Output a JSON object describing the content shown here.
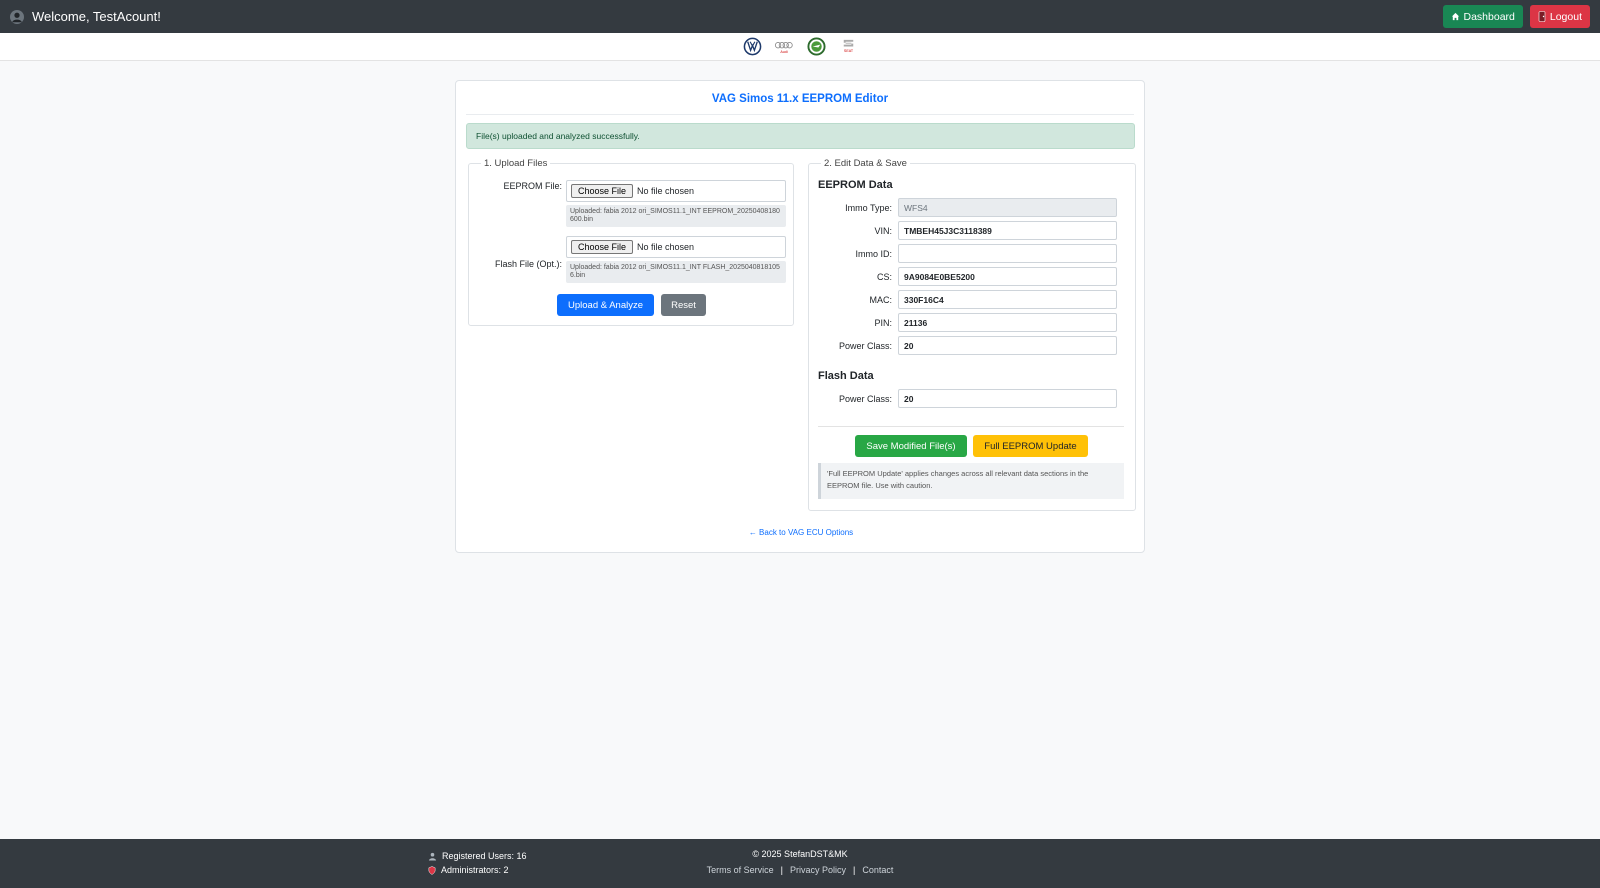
{
  "header": {
    "welcome": "Welcome, TestAcount!",
    "dashboard_label": "Dashboard",
    "logout_label": "Logout"
  },
  "brands": [
    "vw-logo",
    "audi-logo",
    "skoda-logo",
    "seat-logo"
  ],
  "brand_labels": {
    "audi": "Audi",
    "seat": "SEAT"
  },
  "card": {
    "title": "VAG Simos 11.x EEPROM Editor",
    "alert": "File(s) uploaded and analyzed successfully."
  },
  "upload": {
    "legend": "1. Upload Files",
    "eeprom_label": "EEPROM File:",
    "flash_label": "Flash File (Opt.):",
    "choose_label": "Choose File",
    "no_file": "No file chosen",
    "eeprom_uploaded": "Uploaded: fabia 2012 ori_SIMOS11.1_INT EEPROM_20250408180600.bin",
    "flash_uploaded": "Uploaded: fabia 2012 ori_SIMOS11.1_INT FLASH_20250408181056.bin",
    "upload_button": "Upload & Analyze",
    "reset_button": "Reset"
  },
  "edit": {
    "legend": "2. Edit Data & Save",
    "eeprom_heading": "EEPROM Data",
    "fields": [
      {
        "label": "Immo Type:",
        "value": "WFS4"
      },
      {
        "label": "VIN:",
        "value": "TMBEH45J3C3118389"
      },
      {
        "label": "Immo ID:",
        "value": ""
      },
      {
        "label": "CS:",
        "value": "9A9084E0BE5200"
      },
      {
        "label": "MAC:",
        "value": "330F16C4"
      },
      {
        "label": "PIN:",
        "value": "21136"
      },
      {
        "label": "Power Class:",
        "value": "20"
      }
    ],
    "flash_heading": "Flash Data",
    "flash_fields": [
      {
        "label": "Power Class:",
        "value": "20"
      }
    ],
    "save_button": "Save Modified File(s)",
    "full_update_button": "Full EEPROM Update",
    "hint": "'Full EEPROM Update' applies changes across all relevant data sections in the EEPROM file. Use with caution."
  },
  "back_link": "← Back to VAG ECU Options",
  "footer": {
    "registered": "Registered Users: 16",
    "admins": "Administrators: 2",
    "copyright": "© 2025 StefanDST&MK",
    "terms": "Terms of Service",
    "privacy": "Privacy Policy",
    "contact": "Contact",
    "separator": "|"
  },
  "colors": {
    "topbar": "#343a40",
    "primary": "#0d6efd",
    "success": "#28a745",
    "warning": "#ffc107",
    "danger": "#dc3545",
    "alert_bg": "#d1e7dd"
  }
}
